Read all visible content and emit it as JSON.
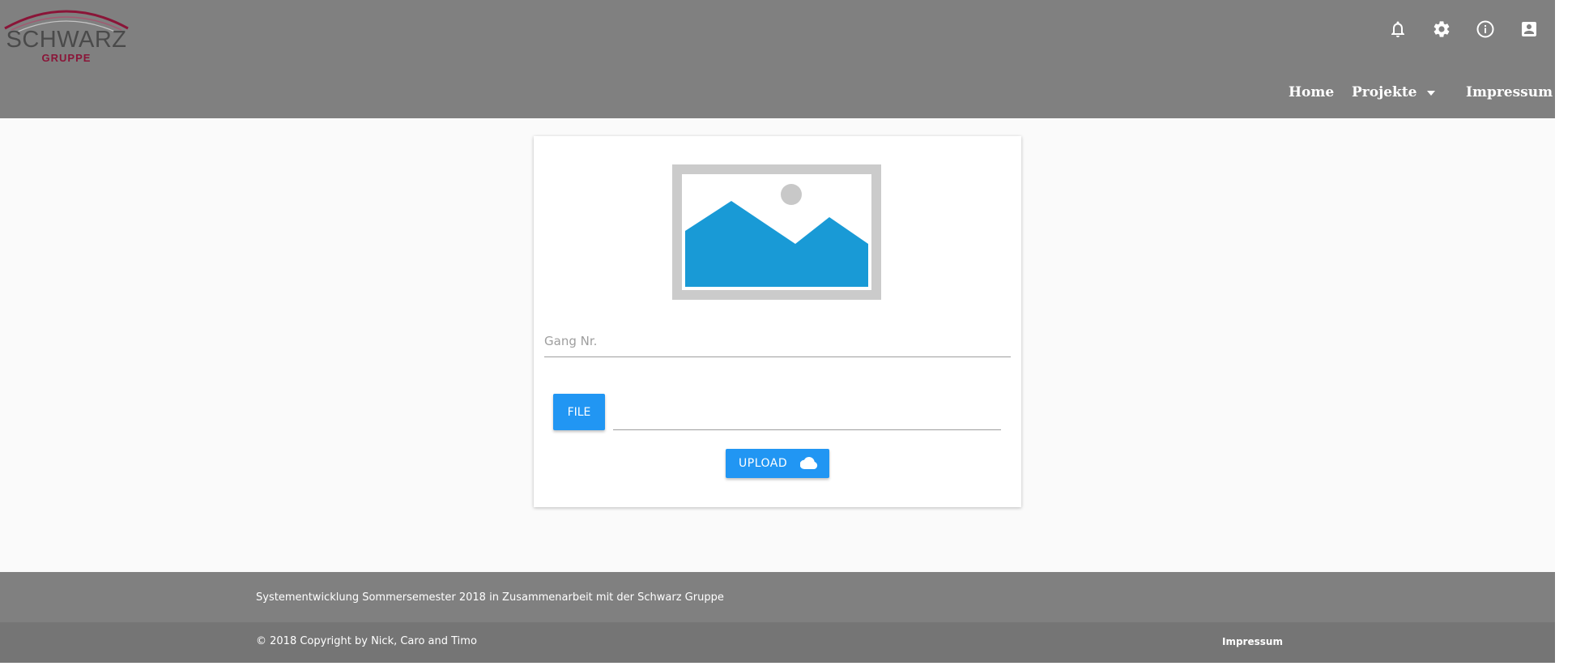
{
  "header": {
    "logo": {
      "word": "SCHWARZ",
      "sub": "GRUPPE",
      "arc_color": "#8a1538"
    },
    "icons": [
      "bell-icon",
      "gear-icon",
      "info-icon",
      "account-box-icon"
    ],
    "nav": {
      "home": "Home",
      "projects": "Projekte",
      "imprint": "Impressum"
    }
  },
  "card": {
    "image_placeholder": {
      "icon": "image-icon",
      "accent": "#199ad6"
    },
    "gang_field": {
      "placeholder": "Gang Nr.",
      "value": ""
    },
    "file_button": "FILE",
    "file_path": "",
    "upload_button": {
      "label": "UPLOAD",
      "icon": "cloud-upload-icon"
    }
  },
  "footer": {
    "description": "Systementwicklung Sommersemester 2018 in Zusammenarbeit mit der Schwarz Gruppe",
    "copyright": "© 2018 Copyright by Nick, Caro and Timo",
    "imprint": "Impressum"
  },
  "colors": {
    "header_bg": "#808080",
    "primary_button": "#2196f3",
    "footer_bottom_bg": "#757575"
  }
}
